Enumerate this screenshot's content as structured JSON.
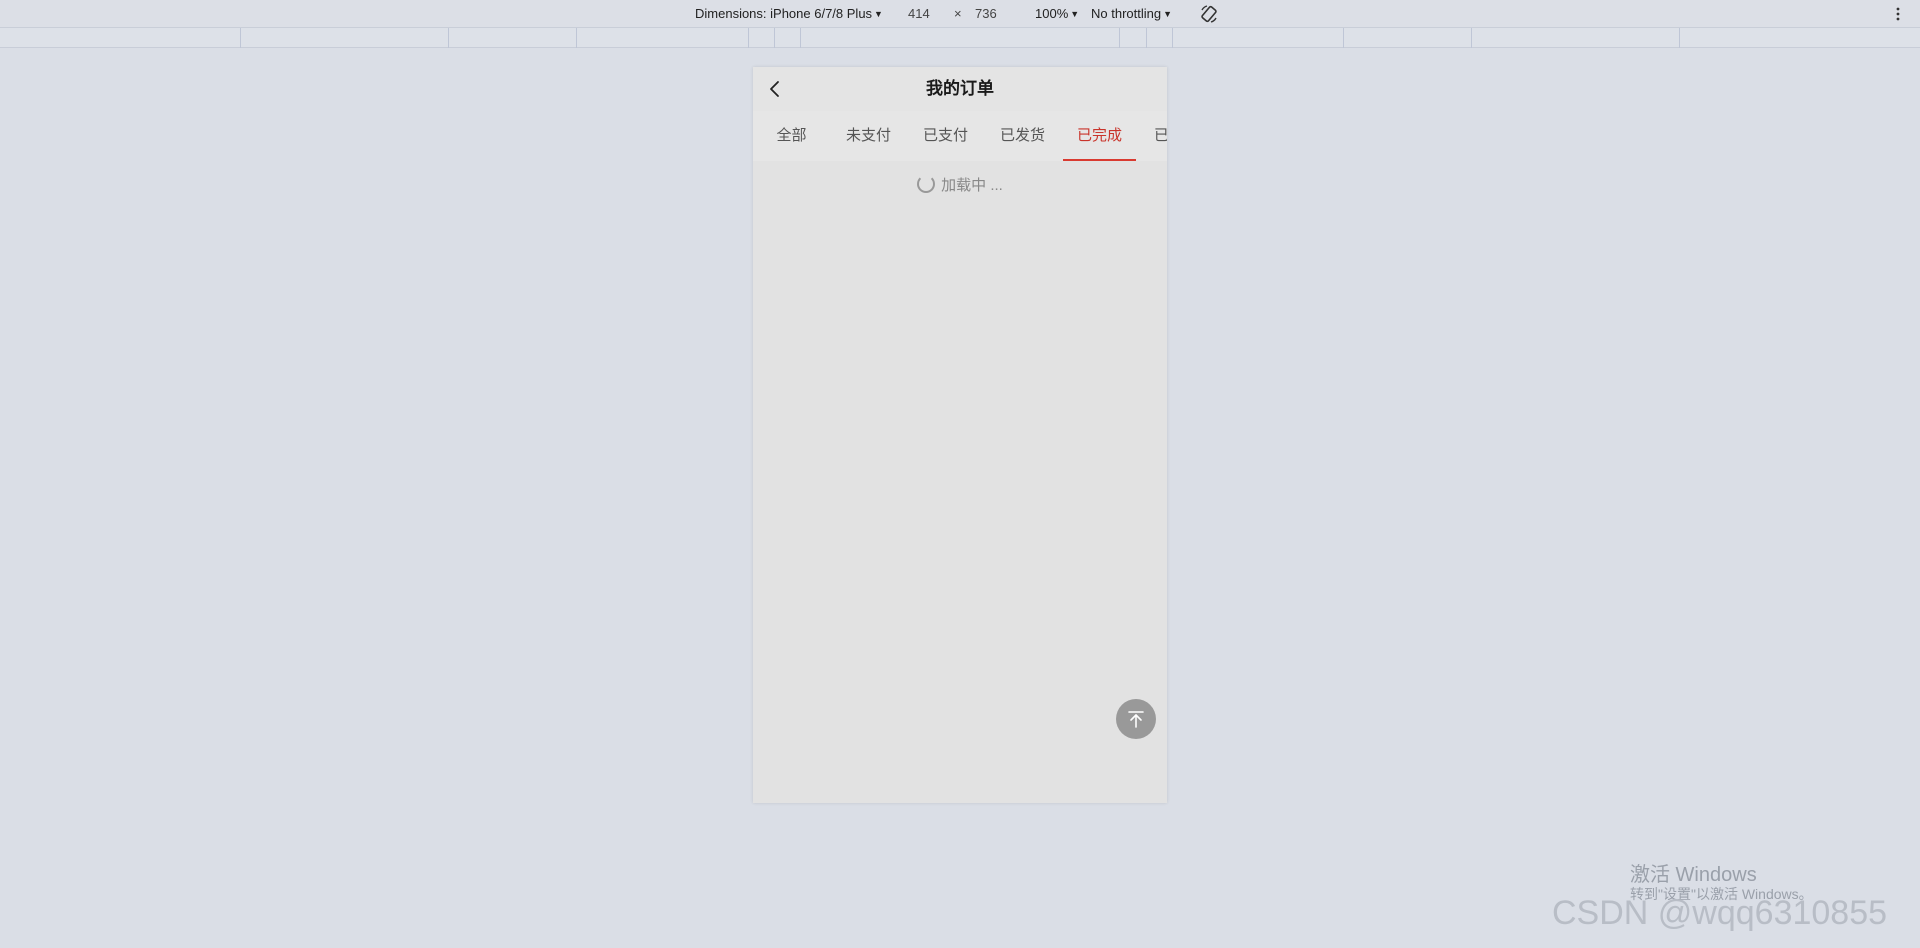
{
  "devtools": {
    "dimensions_label": "Dimensions: iPhone 6/7/8 Plus",
    "width": "414",
    "times": "×",
    "height": "736",
    "zoom": "100%",
    "throttling": "No throttling"
  },
  "app": {
    "title": "我的订单",
    "tabs": [
      "全部",
      "未支付",
      "已支付",
      "已发货",
      "已完成",
      "已取消"
    ],
    "active_tab": 4,
    "loading_text": "加载中 ...",
    "accent_color": "#c9342b"
  },
  "watermark": {
    "activate_title": "激活 Windows",
    "activate_sub": "转到\"设置\"以激活 Windows。",
    "csdn": "CSDN @wqq6310855"
  }
}
